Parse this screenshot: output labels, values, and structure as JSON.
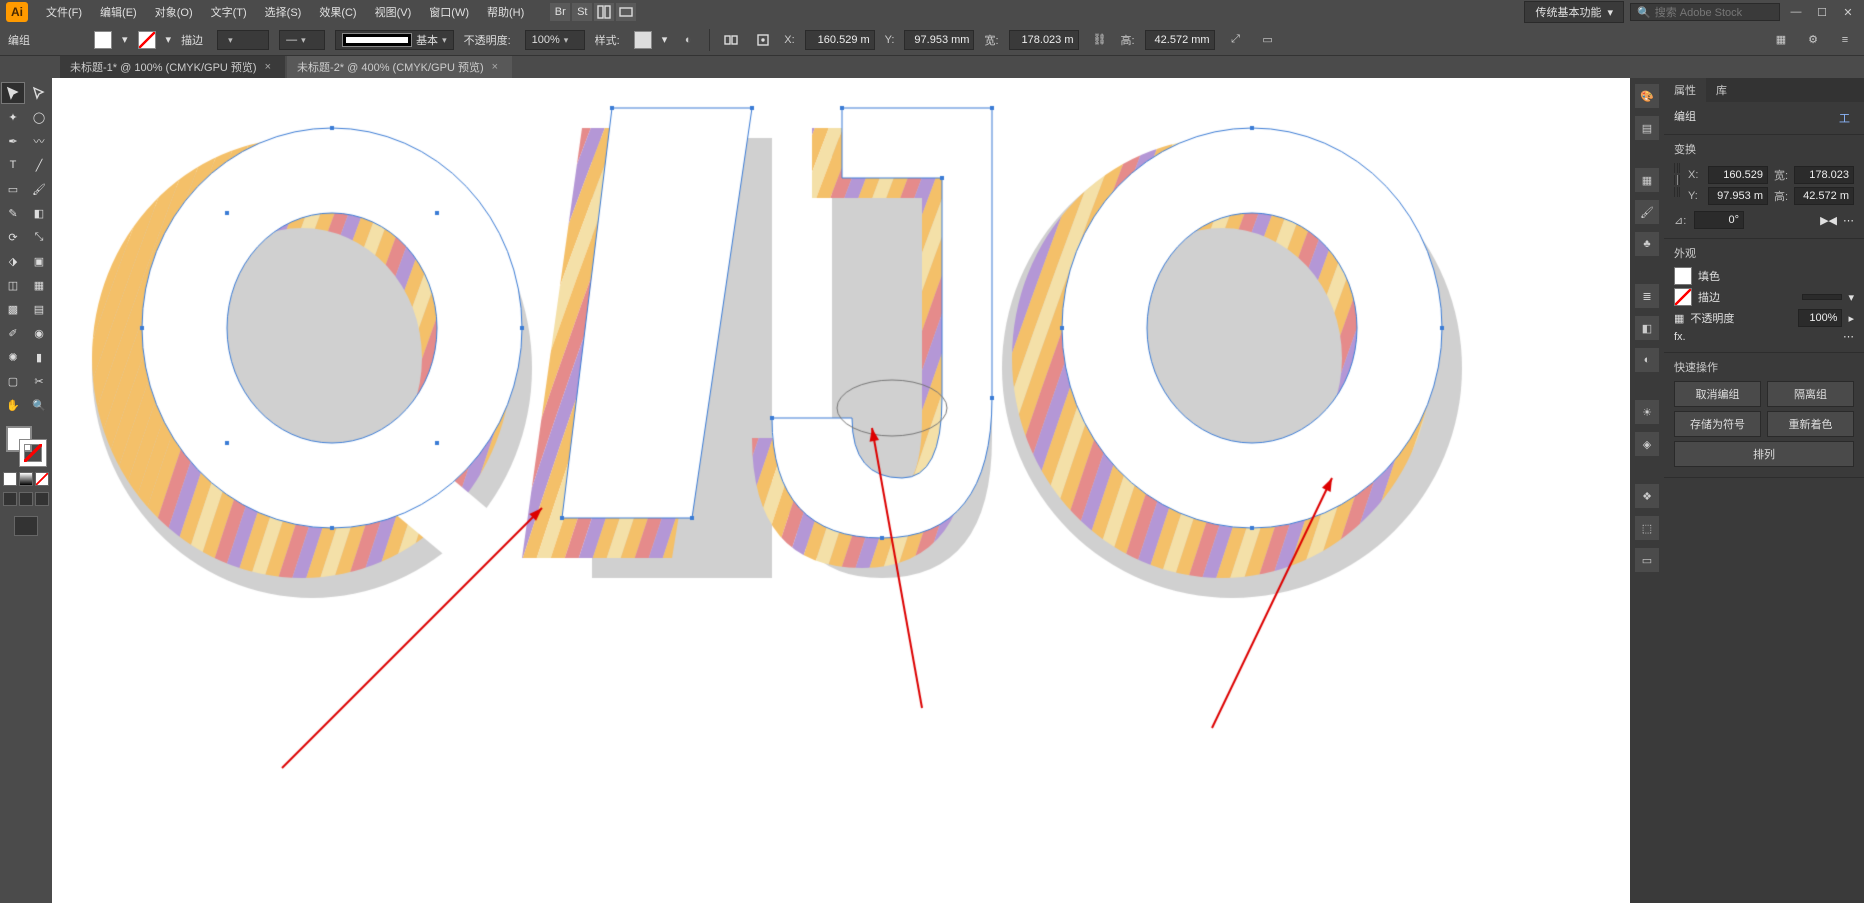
{
  "menu": {
    "items": [
      "文件(F)",
      "编辑(E)",
      "对象(O)",
      "文字(T)",
      "选择(S)",
      "效果(C)",
      "视图(V)",
      "窗口(W)",
      "帮助(H)"
    ],
    "workspace": "传统基本功能",
    "search_placeholder": "搜索 Adobe Stock"
  },
  "control": {
    "left_label": "编组",
    "stroke_label": "描边",
    "stroke_weight": "",
    "brush_label": "基本",
    "opacity_label": "不透明度:",
    "opacity_value": "100%",
    "style_label": "样式:",
    "x_label": "X:",
    "x_value": "160.529 m",
    "y_label": "Y:",
    "y_value": "97.953 mm",
    "w_label": "宽:",
    "w_value": "178.023 m",
    "h_label": "高:",
    "h_value": "42.572 mm"
  },
  "tabs": [
    {
      "label": "未标题-1* @ 100% (CMYK/GPU 预览)",
      "active": false
    },
    {
      "label": "未标题-2* @ 400% (CMYK/GPU 预览)",
      "active": true
    }
  ],
  "properties": {
    "tabs": [
      "属性",
      "库"
    ],
    "heading": "编组",
    "transform_title": "变换",
    "x_label": "X:",
    "x_value": "160.529",
    "y_label": "Y:",
    "y_value": "97.953 m",
    "w_label": "宽:",
    "w_value": "178.023",
    "h_label": "高:",
    "h_value": "42.572 m",
    "angle_label": "⊿:",
    "angle_value": "0°",
    "flip_label": "▶◀ ⟳",
    "appearance_title": "外观",
    "fill_label": "填色",
    "stroke_label": "描边",
    "stroke_weight": "",
    "opacity_label": "不透明度",
    "opacity_value": "100%",
    "fx_label": "fx.",
    "quick_title": "快速操作",
    "btn_ungroup": "取消编组",
    "btn_isolate": "隔离组",
    "btn_savesymbol": "存储为符号",
    "btn_recolor": "重新着色",
    "btn_arrange": "排列",
    "expand": "工"
  }
}
